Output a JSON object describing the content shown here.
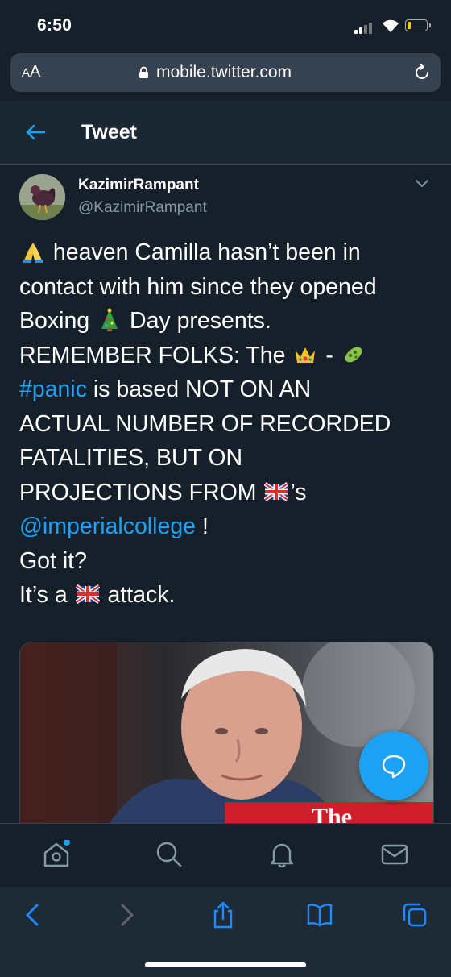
{
  "status": {
    "time": "6:50"
  },
  "browser": {
    "aa_label_big": "A",
    "aa_label_small": "A",
    "url": "mobile.twitter.com"
  },
  "header": {
    "title": "Tweet"
  },
  "author": {
    "name": "KazimirRampant",
    "handle": "@KazimirRampant"
  },
  "tweet": {
    "line1_text": " heaven Camilla hasn’t been in",
    "line2_text": "contact with him since they opened",
    "line3_a": "Boxing ",
    "line3_b": " Day presents.",
    "line4_a": "REMEMBER FOLKS:  The ",
    "line4_b": " - ",
    "line5_link": "#panic",
    "line5_text": " is based NOT ON AN",
    "line6_text": "ACTUAL NUMBER OF RECORDED",
    "line7_text": "FATALITIES, BUT ON",
    "line8_a": "PROJECTIONS FROM ",
    "line8_b": "’s",
    "line9_link": "@imperialcollege",
    "line9_text": " !",
    "line10_text": "Got it?",
    "line11_a": "It’s a ",
    "line11_b": " attack."
  },
  "media": {
    "headline": "The"
  },
  "colors": {
    "accent": "#1da1f2",
    "background": "#15202b",
    "headline_red": "#d01f2a"
  },
  "icons": {
    "emoji": [
      "folded-hands-emoji",
      "christmas-tree-emoji",
      "crown-emoji",
      "microbe-emoji",
      "uk-flag-emoji"
    ],
    "bottom_nav": [
      "home-icon",
      "search-icon",
      "notifications-icon",
      "messages-icon"
    ],
    "safari_toolbar": [
      "back-icon",
      "forward-icon",
      "share-icon",
      "bookmarks-icon",
      "tabs-icon"
    ]
  }
}
